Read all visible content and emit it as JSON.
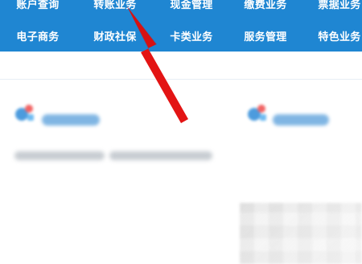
{
  "nav": {
    "row1": [
      {
        "label": "账户查询"
      },
      {
        "label": "转账业务"
      },
      {
        "label": "现金管理"
      },
      {
        "label": "缴费业务"
      },
      {
        "label": "票据业务"
      }
    ],
    "row2": [
      {
        "label": "电子商务"
      },
      {
        "label": "财政社保"
      },
      {
        "label": "卡类业务"
      },
      {
        "label": "服务管理"
      },
      {
        "label": "特色业务"
      }
    ]
  },
  "colors": {
    "nav_bg": "#1f86d2",
    "arrow": "#e31414"
  },
  "annotation": {
    "arrow_icon": "red-arrow-pointer-icon"
  }
}
